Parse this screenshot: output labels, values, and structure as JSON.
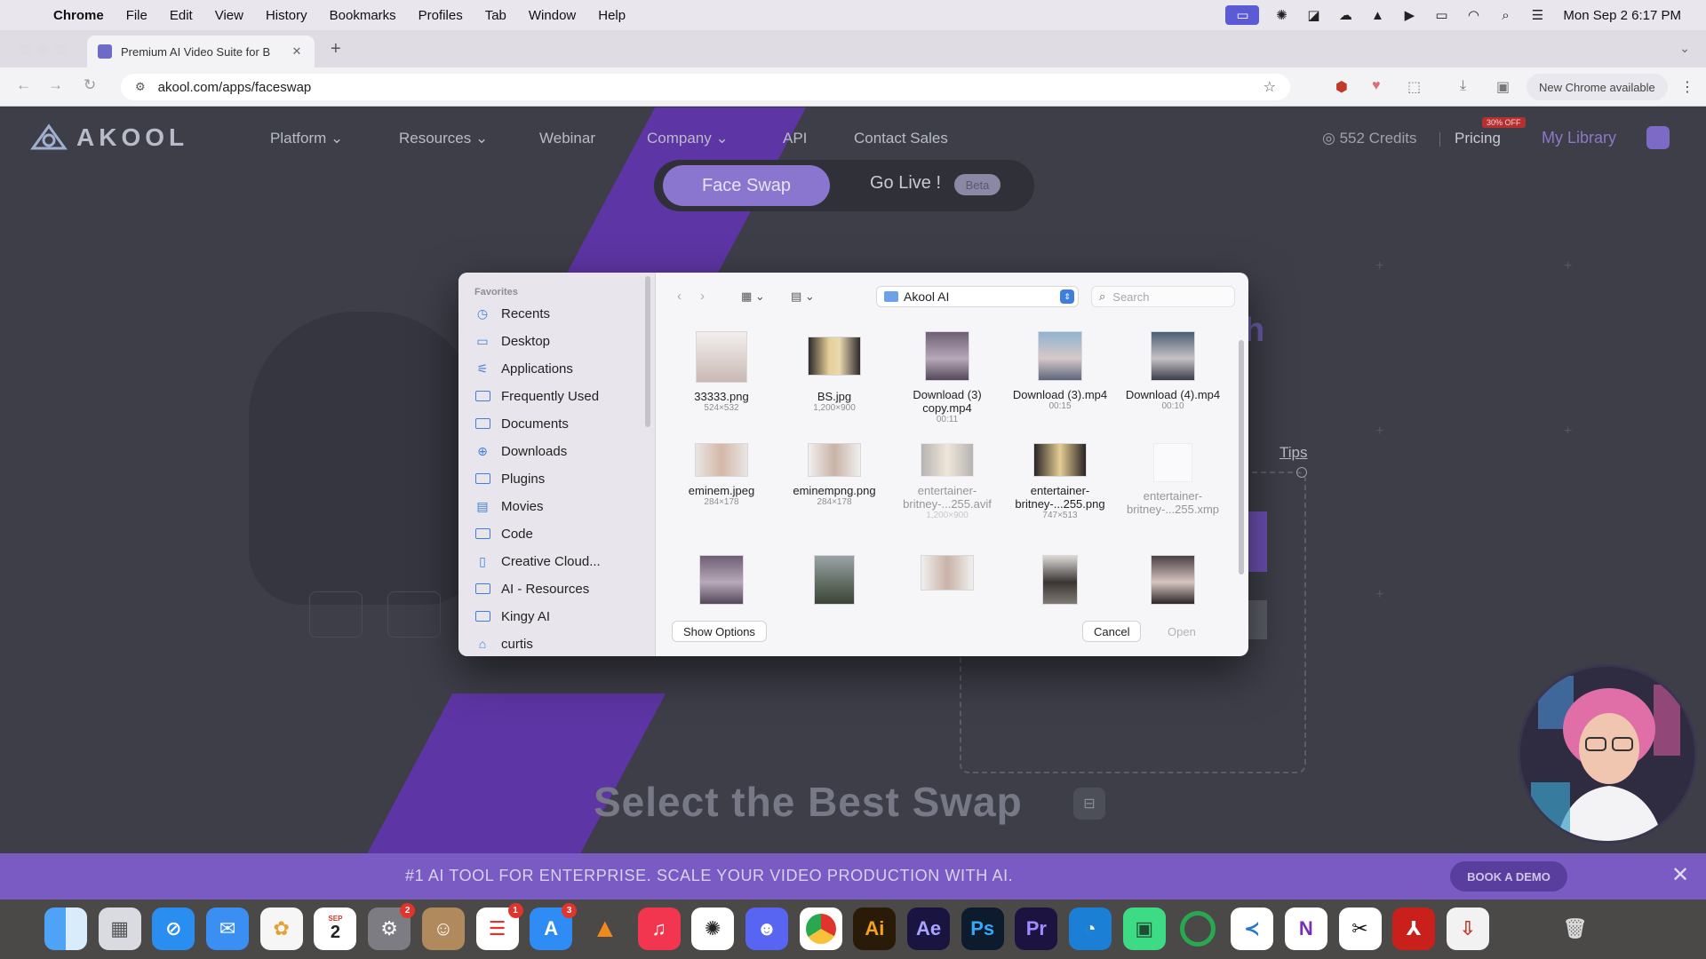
{
  "menubar": {
    "items": [
      "Chrome",
      "File",
      "Edit",
      "View",
      "History",
      "Bookmarks",
      "Profiles",
      "Tab",
      "Window",
      "Help"
    ],
    "clock": "Mon Sep 2  6:17 PM"
  },
  "browser": {
    "tab_title": "Premium AI Video Suite for B",
    "url": "akool.com/apps/faceswap",
    "new_chrome": "New Chrome available"
  },
  "site": {
    "logo": "AKOOL",
    "nav": [
      "Platform",
      "Resources",
      "Webinar",
      "Company",
      "API",
      "Contact Sales"
    ],
    "credits": "552 Credits",
    "pricing": "Pricing",
    "off_badge": "30% OFF",
    "my_library": "My Library",
    "mode_faceswap": "Face Swap",
    "mode_golive": "Go Live !",
    "beta": "Beta",
    "tips": "Tips",
    "heading_fragment": "h",
    "best_swap": "Select the Best Swap"
  },
  "promo": {
    "text": "#1 AI TOOL FOR ENTERPRISE. SCALE YOUR VIDEO PRODUCTION WITH AI.",
    "cta": "BOOK A DEMO"
  },
  "dialog": {
    "sidebar_header": "Favorites",
    "sidebar": [
      "Recents",
      "Desktop",
      "Applications",
      "Frequently Used",
      "Documents",
      "Downloads",
      "Plugins",
      "Movies",
      "Code",
      "Creative Cloud...",
      "AI - Resources",
      "Kingy AI",
      "curtis"
    ],
    "location": "Akool AI",
    "search_placeholder": "Search",
    "files": [
      {
        "name": "33333.png",
        "meta": "524×532"
      },
      {
        "name": "BS.jpg",
        "meta": "1,200×900"
      },
      {
        "name": "Download (3) copy.mp4",
        "meta": "00:11"
      },
      {
        "name": "Download (3).mp4",
        "meta": "00:15"
      },
      {
        "name": "Download (4).mp4",
        "meta": "00:10"
      },
      {
        "name": "eminem.jpeg",
        "meta": "284×178"
      },
      {
        "name": "eminempng.png",
        "meta": "284×178"
      },
      {
        "name": "entertainer-britney-...255.avif",
        "meta": "1,200×900"
      },
      {
        "name": "entertainer-britney-...255.png",
        "meta": "747×513"
      },
      {
        "name": "entertainer-britney-...255.xmp",
        "meta": ""
      }
    ],
    "show_options": "Show Options",
    "cancel": "Cancel",
    "open": "Open"
  },
  "dock_apps": [
    "finder",
    "launchpad",
    "safari",
    "mail",
    "photos",
    "calendar",
    "system-settings",
    "contacts",
    "reminders",
    "app-store",
    "vlc",
    "music",
    "chatgpt",
    "discord",
    "chrome",
    "illustrator",
    "after-effects",
    "photoshop",
    "premiere",
    "edge",
    "android-studio",
    "loading",
    "vscode",
    "onenote",
    "capcut",
    "acrobat",
    "archive",
    "trash"
  ],
  "dock_badges": {
    "system-settings": "2",
    "reminders": "1",
    "app-store": "3"
  },
  "calendar_day": "2",
  "calendar_month": "SEP"
}
